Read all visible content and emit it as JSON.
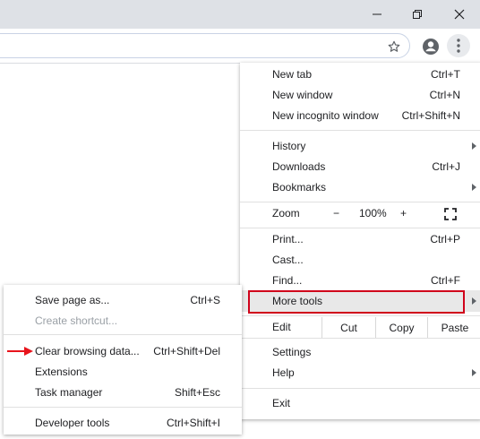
{
  "titlebar": {
    "min_icon": "minimize-icon",
    "restore_icon": "restore-icon",
    "close_icon": "close-icon"
  },
  "toolbar": {
    "star_icon": "star-icon",
    "profile_icon": "profile-icon",
    "menu_icon": "kebab-menu-icon"
  },
  "main_menu": {
    "new_tab": {
      "label": "New tab",
      "shortcut": "Ctrl+T"
    },
    "new_window": {
      "label": "New window",
      "shortcut": "Ctrl+N"
    },
    "new_incognito": {
      "label": "New incognito window",
      "shortcut": "Ctrl+Shift+N"
    },
    "history": {
      "label": "History"
    },
    "downloads": {
      "label": "Downloads",
      "shortcut": "Ctrl+J"
    },
    "bookmarks": {
      "label": "Bookmarks"
    },
    "zoom": {
      "label": "Zoom",
      "minus": "−",
      "value": "100%",
      "plus": "+",
      "fullscreen_icon": "fullscreen-icon"
    },
    "print": {
      "label": "Print...",
      "shortcut": "Ctrl+P"
    },
    "cast": {
      "label": "Cast..."
    },
    "find": {
      "label": "Find...",
      "shortcut": "Ctrl+F"
    },
    "more_tools": {
      "label": "More tools"
    },
    "edit": {
      "label": "Edit",
      "cut": "Cut",
      "copy": "Copy",
      "paste": "Paste"
    },
    "settings": {
      "label": "Settings"
    },
    "help": {
      "label": "Help"
    },
    "exit": {
      "label": "Exit"
    }
  },
  "sub_menu": {
    "save_page": {
      "label": "Save page as...",
      "shortcut": "Ctrl+S"
    },
    "create_shortcut": {
      "label": "Create shortcut..."
    },
    "clear_browsing": {
      "label": "Clear browsing data...",
      "shortcut": "Ctrl+Shift+Del"
    },
    "extensions": {
      "label": "Extensions"
    },
    "task_manager": {
      "label": "Task manager",
      "shortcut": "Shift+Esc"
    },
    "developer_tools": {
      "label": "Developer tools",
      "shortcut": "Ctrl+Shift+I"
    }
  },
  "colors": {
    "highlight_border": "#d0021b",
    "arrow_annotation": "#e8141c",
    "hover_bg": "#e8e8e8"
  }
}
